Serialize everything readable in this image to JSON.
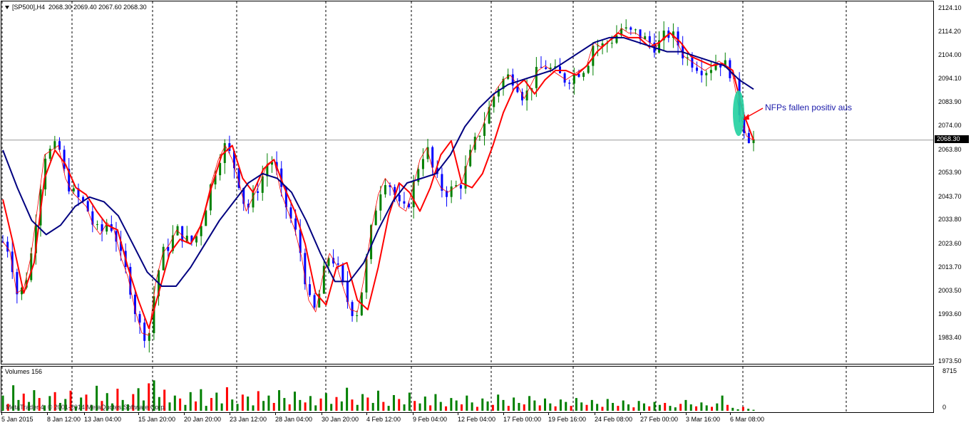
{
  "chart_header": "[SP500],H4  2068.30 2069.40 2067.60 2068.30",
  "volume_header": "Volumes 156",
  "watermark": "MetaTrader 4, © 2001-2014 MetaQuotes Software Corp.",
  "current_price_label": "2068.30",
  "annotation": "NFPs fallen positiv aus",
  "colors": {
    "bull": "#008000",
    "bear": "#0000ff",
    "ma_fast": "#ff0000",
    "ma_slow": "#000080",
    "vol_up": "#008000",
    "vol_down": "#ff0000",
    "highlight": "#20d0a0",
    "grid": "#000000"
  },
  "chart_data": [
    {
      "type": "candlestick",
      "symbol": "SP500",
      "timeframe": "H4",
      "price_ticks": [
        "2124.10",
        "2114.20",
        "2104.00",
        "2094.10",
        "2083.90",
        "2074.00",
        "2063.80",
        "2053.90",
        "2043.70",
        "2033.80",
        "2023.60",
        "2013.70",
        "2003.50",
        "1993.60",
        "1983.40",
        "1973.50"
      ],
      "date_ticks": [
        "5 Jan 2015",
        "8 Jan 12:00",
        "13 Jan 04:00",
        "15 Jan 20:00",
        "20 Jan 20:00",
        "23 Jan 12:00",
        "28 Jan 04:00",
        "30 Jan 20:00",
        "4 Feb 12:00",
        "9 Feb 04:00",
        "12 Feb 04:00",
        "17 Feb 00:00",
        "19 Feb 16:00",
        "24 Feb 08:00",
        "27 Feb 00:00",
        "3 Mar 16:00",
        "6 Mar 08:00"
      ],
      "ylim": [
        1973.5,
        2127.0
      ],
      "close_path": [
        2025,
        2021,
        2003,
        2005,
        2018,
        2040,
        2062,
        2064,
        2066,
        2052,
        2046,
        2043,
        2040,
        2032,
        2028,
        2033,
        2030,
        2018,
        2010,
        1996,
        1986,
        1985,
        2008,
        2020,
        2024,
        2030,
        2027,
        2024,
        2028,
        2038,
        2050,
        2060,
        2066,
        2060,
        2050,
        2038,
        2044,
        2050,
        2058,
        2060,
        2046,
        2038,
        2030,
        2018,
        2000,
        1995,
        2010,
        2020,
        2015,
        2005,
        1996,
        1995,
        2010,
        2030,
        2045,
        2052,
        2048,
        2040,
        2038,
        2048,
        2060,
        2065,
        2054,
        2048,
        2046,
        2048,
        2050,
        2060,
        2068,
        2074,
        2082,
        2090,
        2094,
        2096,
        2092,
        2086,
        2092,
        2098,
        2100,
        2098,
        2096,
        2094,
        2096,
        2098,
        2100,
        2110,
        2108,
        2110,
        2112,
        2116,
        2114,
        2114,
        2112,
        2110,
        2108,
        2112,
        2114,
        2110,
        2104,
        2102,
        2100,
        2098,
        2100,
        2102,
        2100,
        2096,
        2080,
        2070,
        2068.3
      ],
      "ma_fast_points": [
        2043,
        2024,
        2003,
        2016,
        2052,
        2064,
        2058,
        2048,
        2045,
        2038,
        2032,
        2030,
        2014,
        2000,
        1988,
        2004,
        2020,
        2026,
        2024,
        2032,
        2048,
        2062,
        2066,
        2052,
        2046,
        2056,
        2060,
        2048,
        2038,
        2024,
        2003,
        1998,
        2014,
        2016,
        2000,
        1996,
        2014,
        2036,
        2050,
        2046,
        2038,
        2048,
        2062,
        2068,
        2050,
        2048,
        2054,
        2066,
        2080,
        2090,
        2094,
        2088,
        2094,
        2098,
        2098,
        2096,
        2100,
        2106,
        2110,
        2114,
        2112,
        2112,
        2108,
        2110,
        2114,
        2110,
        2104,
        2102,
        2100,
        2101,
        2098,
        2080,
        2068.3
      ],
      "ma_slow_points": [
        2064,
        2048,
        2034,
        2028,
        2032,
        2040,
        2044,
        2042,
        2036,
        2024,
        2012,
        2006,
        2006,
        2014,
        2024,
        2034,
        2042,
        2050,
        2054,
        2052,
        2046,
        2034,
        2020,
        2008,
        2008,
        2016,
        2030,
        2042,
        2050,
        2052,
        2054,
        2062,
        2074,
        2082,
        2088,
        2092,
        2094,
        2096,
        2098,
        2102,
        2106,
        2110,
        2112,
        2112,
        2110,
        2108,
        2106,
        2106,
        2104,
        2102,
        2100,
        2094,
        2090
      ],
      "last_price": 2068.3
    },
    {
      "type": "bar",
      "series_name": "Volumes",
      "ylim": [
        0,
        8715
      ],
      "y_ticks": [
        "8715",
        "0"
      ],
      "values": [
        3100,
        1400,
        5200,
        2200,
        3500,
        1800,
        4200,
        2600,
        1100,
        3000,
        3800,
        1600,
        2400,
        4100,
        900,
        2700,
        3300,
        1200,
        5100,
        2000,
        3600,
        1500,
        4500,
        2200,
        1300,
        3400,
        4600,
        2100,
        5600,
        6200,
        2800,
        4300,
        1700,
        3100,
        2500,
        1200,
        3800,
        1900,
        4400,
        1000,
        2600,
        3700,
        1500,
        4800,
        2300,
        1400,
        3300,
        2900,
        1100,
        4000,
        2000,
        3100,
        1600,
        4200,
        2600,
        1300,
        3900,
        2200,
        1700,
        3000,
        1100,
        2500,
        3600,
        1400,
        2800,
        1900,
        4700,
        2300,
        1200,
        3400,
        2700,
        1600,
        4100,
        1800,
        1000,
        3200,
        2400,
        1300,
        3700,
        2000,
        1500,
        2900,
        1100,
        3400,
        1800,
        900,
        2600,
        2100,
        1300,
        3100,
        1700,
        800,
        2500,
        1900,
        1200,
        3300,
        2200,
        1000,
        2700,
        1600,
        1300,
        3000,
        2100,
        1100,
        2500,
        1500,
        900,
        2300,
        1800,
        1000,
        2600,
        1700,
        1200,
        2200,
        1400,
        800,
        2400,
        1600,
        1000,
        2100,
        1300,
        700,
        2000,
        1500,
        900,
        1800,
        1200,
        1600,
        1000,
        700,
        1400,
        2200,
        1300,
        900,
        1700,
        1100,
        800,
        1500,
        3100,
        1200,
        600,
        300,
        800,
        400,
        200
      ]
    }
  ]
}
